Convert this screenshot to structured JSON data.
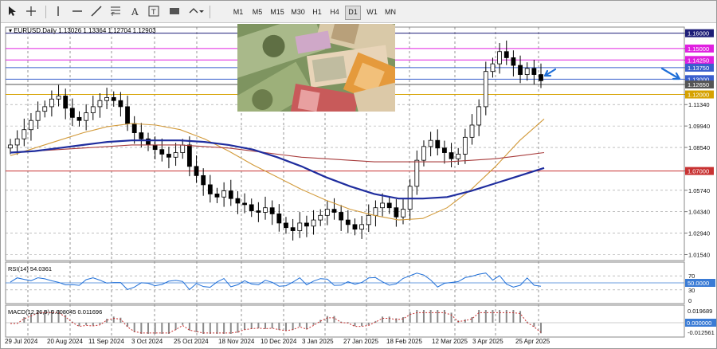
{
  "toolbar": {
    "tools": [
      "cursor-tool",
      "crosshair-tool",
      "vertical-line-tool",
      "horizontal-line-tool",
      "trendline-tool",
      "fibonacci-tool",
      "text-tool",
      "text-label-tool",
      "rectangle-tool",
      "shapes-tool"
    ],
    "timeframes": [
      "M1",
      "M5",
      "M15",
      "M30",
      "H1",
      "H4",
      "D1",
      "W1",
      "MN"
    ],
    "active_timeframe": "D1"
  },
  "chart_data": {
    "type": "candlestick",
    "title": "EURUSD,Daily  1.13026 1.13364 1.12704 1.12903",
    "symbol": "EURUSD",
    "period": "Daily",
    "ohlc": {
      "open": 1.13026,
      "high": 1.13364,
      "low": 1.12704,
      "close": 1.12903
    },
    "price_axis": {
      "range": [
        1.0115,
        1.164
      ],
      "ticks": [
        "1.16000",
        "1.15000",
        "1.14250",
        "1.13750",
        "1.13000",
        "1.12650",
        "1.12000",
        "1.11340",
        "1.09940",
        "1.08540",
        "1.07000",
        "1.05740",
        "1.04340",
        "1.02940",
        "1.01540"
      ]
    },
    "date_axis": [
      "29 Jul 2024",
      "20 Aug 2024",
      "11 Sep 2024",
      "3 Oct 2024",
      "25 Oct 2024",
      "18 Nov 2024",
      "10 Dec 2024",
      "3 Jan 2025",
      "27 Jan 2025",
      "18 Feb 2025",
      "12 Mar 2025",
      "3 Apr 2025",
      "25 Apr 2025"
    ],
    "levels": [
      {
        "price": 1.16,
        "color": "#1e1e78",
        "label": "1.16000"
      },
      {
        "price": 1.15,
        "color": "#e020e0",
        "label": "1.15000"
      },
      {
        "price": 1.1425,
        "color": "#e020e0",
        "label": "1.14250"
      },
      {
        "price": 1.1375,
        "color": "#3a5fcd",
        "label": "1.13750"
      },
      {
        "price": 1.13,
        "color": "#3a5fcd",
        "label": "1.13000"
      },
      {
        "price": 1.1265,
        "color": "#555555",
        "label": "1.12650"
      },
      {
        "price": 1.12,
        "color": "#d6a200",
        "label": "1.12000"
      },
      {
        "price": 1.07,
        "color": "#c83232",
        "label": "1.07000"
      }
    ],
    "close_path": [
      1.087,
      1.091,
      1.097,
      1.103,
      1.109,
      1.112,
      1.117,
      1.119,
      1.111,
      1.105,
      1.103,
      1.108,
      1.112,
      1.116,
      1.118,
      1.116,
      1.112,
      1.101,
      1.095,
      1.091,
      1.087,
      1.084,
      1.081,
      1.079,
      1.082,
      1.087,
      1.073,
      1.067,
      1.061,
      1.055,
      1.053,
      1.057,
      1.052,
      1.049,
      1.048,
      1.044,
      1.043,
      1.046,
      1.042,
      1.036,
      1.033,
      1.031,
      1.036,
      1.034,
      1.038,
      1.041,
      1.045,
      1.043,
      1.038,
      1.035,
      1.032,
      1.035,
      1.041,
      1.046,
      1.049,
      1.046,
      1.04,
      1.045,
      1.06,
      1.077,
      1.086,
      1.09,
      1.085,
      1.082,
      1.078,
      1.081,
      1.092,
      1.1,
      1.112,
      1.135,
      1.14,
      1.148,
      1.144,
      1.139,
      1.133,
      1.137,
      1.133,
      1.129
    ],
    "moving_averages": [
      {
        "color": "#d29a3a",
        "values": [
          1.08,
          1.085,
          1.09,
          1.095,
          1.099,
          1.101,
          1.1,
          1.097,
          1.091,
          1.083,
          1.074,
          1.066,
          1.058,
          1.051,
          1.045,
          1.041,
          1.038,
          1.039,
          1.046,
          1.058,
          1.073,
          1.09,
          1.104
        ]
      },
      {
        "color": "#a83c3c",
        "values": [
          1.082,
          1.083,
          1.084,
          1.085,
          1.086,
          1.087,
          1.087,
          1.087,
          1.086,
          1.085,
          1.083,
          1.081,
          1.079,
          1.078,
          1.077,
          1.076,
          1.076,
          1.076,
          1.076,
          1.077,
          1.078,
          1.08,
          1.082
        ]
      },
      {
        "color": "#1f2d9e",
        "values": [
          1.082,
          1.083,
          1.085,
          1.087,
          1.089,
          1.09,
          1.09,
          1.09,
          1.089,
          1.087,
          1.084,
          1.079,
          1.073,
          1.066,
          1.06,
          1.055,
          1.052,
          1.052,
          1.053,
          1.057,
          1.062,
          1.067,
          1.072
        ]
      }
    ],
    "rsi": {
      "label": "RSI(14) 54.0361",
      "value": 54.0361,
      "levels": [
        "70",
        "50.0000",
        "30",
        "0"
      ]
    },
    "macd": {
      "label": "MACD(12,26,9) 0.008045 0.011696",
      "macd": 0.008045,
      "signal": 0.011696,
      "ticks": [
        "0.019689",
        "0.000000",
        "-0.012561"
      ]
    }
  },
  "colors": {
    "accent": "#1f6fd8",
    "grid": "#707070",
    "up": "#000000"
  }
}
